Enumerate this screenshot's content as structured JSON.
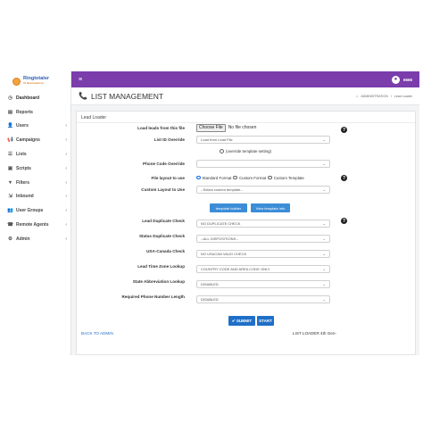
{
  "logo": {
    "name": "Ringtotaler",
    "tagline": "UI Development"
  },
  "sidebar": {
    "items": [
      {
        "label": "Dashboard",
        "icon": "speedometer-icon",
        "glyph": "◷",
        "has_chevron": false
      },
      {
        "label": "Reports",
        "icon": "report-icon",
        "glyph": "▤",
        "has_chevron": false
      },
      {
        "label": "Users",
        "icon": "user-icon",
        "glyph": "👤",
        "has_chevron": true
      },
      {
        "label": "Campaigns",
        "icon": "megaphone-icon",
        "glyph": "📢",
        "has_chevron": true
      },
      {
        "label": "Lists",
        "icon": "list-icon",
        "glyph": "☰",
        "has_chevron": true
      },
      {
        "label": "Scripts",
        "icon": "script-icon",
        "glyph": "▣",
        "has_chevron": true
      },
      {
        "label": "Filters",
        "icon": "filter-icon",
        "glyph": "▼",
        "has_chevron": true
      },
      {
        "label": "Inbound",
        "icon": "inbound-icon",
        "glyph": "⇲",
        "has_chevron": true
      },
      {
        "label": "User Groups",
        "icon": "group-icon",
        "glyph": "👥",
        "has_chevron": true
      },
      {
        "label": "Remote Agents",
        "icon": "agent-icon",
        "glyph": "☎",
        "has_chevron": true
      },
      {
        "label": "Admin",
        "icon": "gear-icon",
        "glyph": "⚙",
        "has_chevron": true
      }
    ],
    "chevron": "‹"
  },
  "topbar": {
    "menu_glyph": "≡",
    "username": "6666",
    "avatar_glyph": "●"
  },
  "page": {
    "title": "LIST MANAGEMENT",
    "breadcrumb": {
      "home": "ADMINISTRATION",
      "separator": "/",
      "current": "Lead Loader"
    }
  },
  "card": {
    "title": "Lead Loader"
  },
  "form": {
    "load_leads": {
      "label": "Load leads from this file",
      "button": "Choose File",
      "status": "No file chosen"
    },
    "list_id_override": {
      "label": "List ID Override",
      "value": "Load from Lead File"
    },
    "override_template": {
      "label": "(override template setting)"
    },
    "phone_code_override": {
      "label": "Phone Code Override",
      "value": ""
    },
    "file_layout": {
      "label": "File layout to use",
      "options": [
        "Standard Format",
        "Custom Format",
        "Custom Template"
      ],
      "selected": "Standard Format"
    },
    "custom_layout": {
      "label": "Custom Layout to Use",
      "value": "--Select custom template--"
    },
    "template_builder": "template builder",
    "view_template_info": "View template info",
    "lead_duplicate_check": {
      "label": "Lead Duplicate Check",
      "value": "NO DUPLICATE CHECK"
    },
    "status_duplicate_check": {
      "label": "Status Duplicate Check",
      "value": "--ALL DISPOSITIONS--"
    },
    "usa_canada_check": {
      "label": "USA-Canada Check",
      "value": "NO USACAN VALID CHECK"
    },
    "lead_time_zone_lookup": {
      "label": "Lead Time Zone Lookup",
      "value": "COUNTRY CODE AND AREA CODE ONLY"
    },
    "state_abbreviation_lookup": {
      "label": "State Abbreviation Lookup",
      "value": "DISABLED"
    },
    "required_phone_number_length": {
      "label": "Required Phone Number Length",
      "value": "DISABLED"
    },
    "submit": "SUBMIT",
    "start": "START",
    "help_glyph": "?",
    "caret_glyph": "⌄"
  },
  "footer": {
    "back_link": "BACK TO ADMIN",
    "version": "LIST LOADER 4th Gen-"
  },
  "colors": {
    "topbar": "#7a3dab",
    "primary_button": "#3c8dd8",
    "submit_button": "#1f6fc8"
  }
}
